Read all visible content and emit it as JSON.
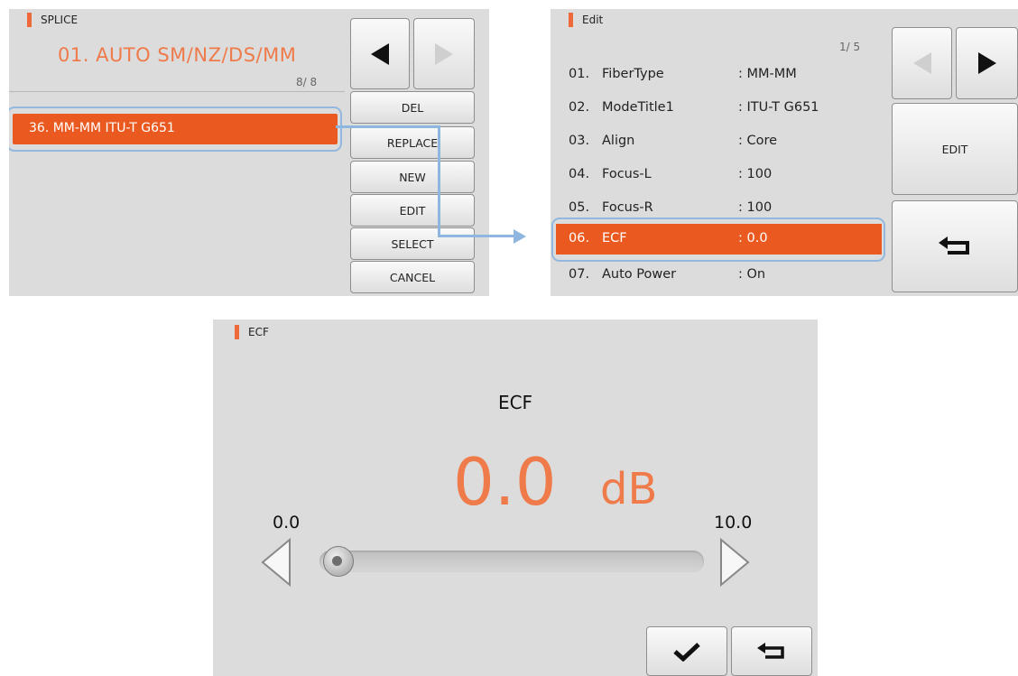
{
  "splice": {
    "title": "SPLICE",
    "mode": "01. AUTO SM/NZ/DS/MM",
    "counter": "8/ 8",
    "selected": "36. MM-MM ITU-T G651",
    "buttons": [
      "DEL",
      "REPLACE",
      "NEW",
      "EDIT",
      "SELECT",
      "CANCEL"
    ],
    "icons": {
      "prev": "triangle-left-icon",
      "next": "triangle-right-icon-disabled"
    }
  },
  "edit": {
    "title": "Edit",
    "page": "1/ 5",
    "rows": [
      {
        "num": "01.",
        "name": "FiberType",
        "value": ": MM-MM"
      },
      {
        "num": "02.",
        "name": "ModeTitle1",
        "value": ": ITU-T G651"
      },
      {
        "num": "03.",
        "name": "Align",
        "value": ": Core"
      },
      {
        "num": "04.",
        "name": "Focus-L",
        "value": ": 100"
      },
      {
        "num": "05.",
        "name": "Focus-R",
        "value": ": 100"
      },
      {
        "num": "06.",
        "name": "ECF",
        "value": ": 0.0"
      },
      {
        "num": "07.",
        "name": "Auto Power",
        "value": ": On"
      }
    ],
    "edit_label": "EDIT",
    "icons": {
      "prev": "triangle-left-icon-disabled",
      "next": "triangle-right-icon",
      "back": "return-arrow-icon"
    }
  },
  "ecf": {
    "title": "ECF",
    "heading": "ECF",
    "value": "0.0",
    "unit": "dB",
    "min_label": "0.0",
    "max_label": "10.0",
    "slider_fraction": 0.0,
    "icons": {
      "decrease": "outline-triangle-left-icon",
      "increase": "outline-triangle-right-icon",
      "confirm": "checkmark-icon",
      "back": "return-arrow-icon"
    }
  },
  "colors": {
    "accent": "#ea5a20",
    "highlight": "#93b7de",
    "panel": "#dcdcdc"
  }
}
